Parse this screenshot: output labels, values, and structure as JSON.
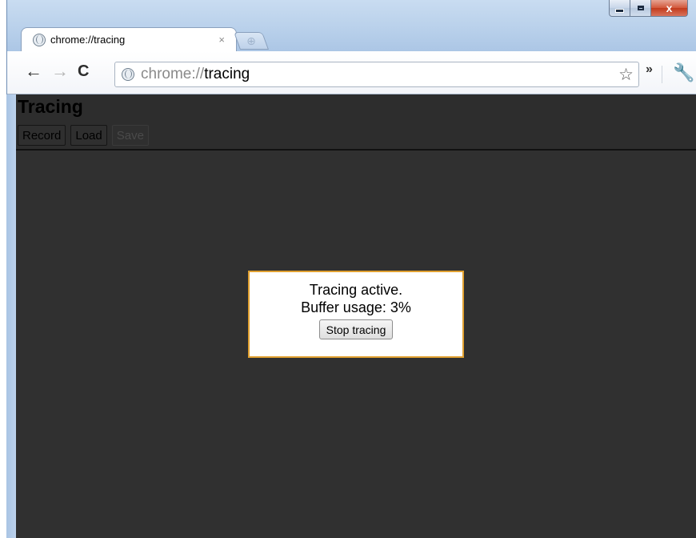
{
  "window": {
    "tab_title": "chrome://tracing",
    "tab_close": "×",
    "newtab_icon": "⊕",
    "min_icon": "minimize-icon",
    "max_icon": "maximize-icon",
    "close_glyph": "x"
  },
  "toolbar": {
    "back_glyph": "←",
    "forward_glyph": "→",
    "reload_glyph": "C",
    "url_scheme": "chrome://",
    "url_host": "tracing",
    "star_glyph": "☆",
    "overflow_glyph": "»",
    "wrench_glyph": "🔧"
  },
  "page": {
    "title": "Tracing",
    "buttons": {
      "record": "Record",
      "load": "Load",
      "save": "Save"
    }
  },
  "dialog": {
    "line1": "Tracing active.",
    "line2": "Buffer usage: 3%",
    "buffer_usage_percent": 3,
    "stop_label": "Stop tracing"
  },
  "colors": {
    "page_background": "#303030",
    "dialog_border": "#e0a030"
  }
}
